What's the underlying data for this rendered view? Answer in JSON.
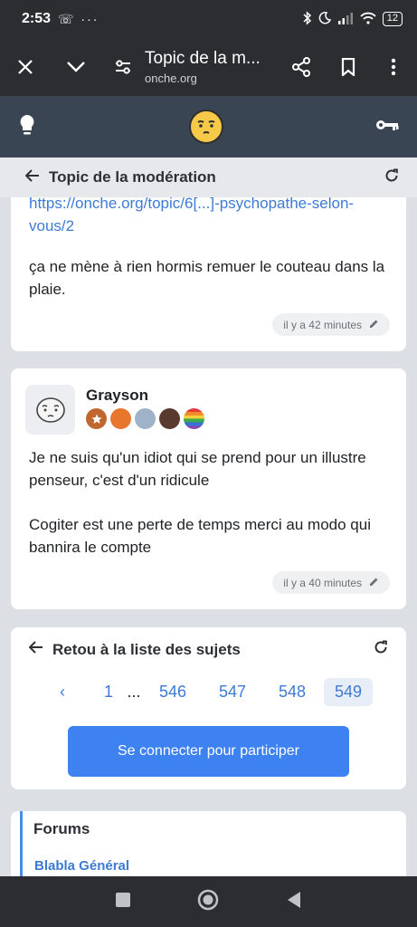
{
  "status_bar": {
    "time": "2:53",
    "left_icons": "☏ ···",
    "battery": "12"
  },
  "browser": {
    "title": "Topic de la m...",
    "url": "onche.org"
  },
  "topic_header": {
    "title": "Topic de la modération"
  },
  "post1": {
    "link": "https://onche.org/topic/6[...]-psychopathe-selon-vous/2",
    "message": "ça ne mène à rien hormis remuer le couteau dans la plaie.",
    "time": "il y a 42 minutes"
  },
  "post2": {
    "username": "Grayson",
    "line1": "Je ne suis qu'un idiot qui se prend pour un illustre penseur, c'est d'un ridicule",
    "line2": "Cogiter est une perte de temps merci au modo qui bannira le compte",
    "time": "il y a 40 minutes"
  },
  "pagination": {
    "back_label": "Retou à la liste des sujets",
    "prev": "‹",
    "pages": [
      "1",
      "...",
      "546",
      "547",
      "548",
      "549"
    ],
    "active_page": "549",
    "connect_button": "Se connecter pour participer"
  },
  "forums": {
    "title": "Forums",
    "first_item": "Blabla Général"
  },
  "colors": {
    "accent": "#3d82f0",
    "link": "#3d7ad6",
    "header_bg": "#3a4553",
    "logo": "#f6c948"
  }
}
